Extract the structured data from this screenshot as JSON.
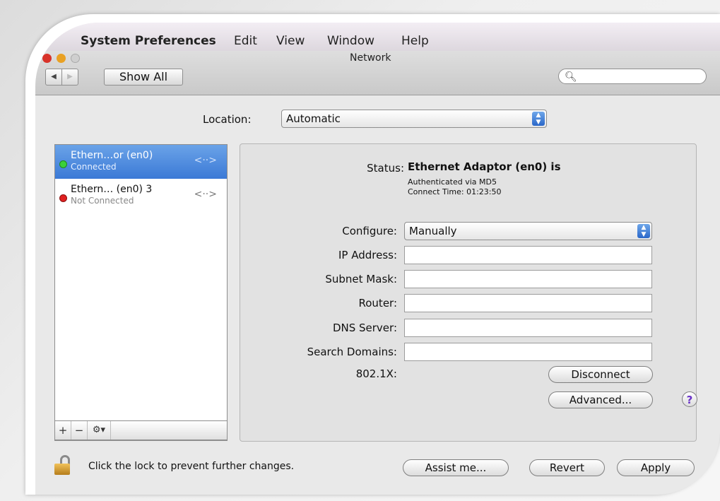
{
  "menubar": {
    "app": "System Preferences",
    "items": [
      "Edit",
      "View",
      "Window",
      "Help"
    ]
  },
  "window": {
    "title": "Network",
    "show_all": "Show All",
    "search_placeholder": ""
  },
  "location": {
    "label": "Location:",
    "value": "Automatic"
  },
  "services": [
    {
      "name": "Ethern…or (en0)",
      "status": "Connected",
      "indicator": "green",
      "selected": true
    },
    {
      "name": "Ethern… (en0) 3",
      "status": "Not Connected",
      "indicator": "red",
      "selected": false
    }
  ],
  "service_toolbar": {
    "add": "+",
    "remove": "−",
    "gear": "⚙▾"
  },
  "detail": {
    "status_label": "Status:",
    "status_value": "Ethernet Adaptor (en0) is",
    "status_line1": "Authenticated via MD5",
    "status_line2": "Connect Time: 01:23:50",
    "configure_label": "Configure:",
    "configure_value": "Manually",
    "ip_label": "IP Address:",
    "ip_value": "",
    "subnet_label": "Subnet Mask:",
    "subnet_value": "",
    "router_label": "Router:",
    "router_value": "",
    "dns_label": "DNS Server:",
    "dns_value": "",
    "search_domains_label": "Search Domains:",
    "search_domains_value": "",
    "dot1x_label": "802.1X:",
    "disconnect": "Disconnect",
    "advanced": "Advanced...",
    "help": "?"
  },
  "footer": {
    "lock_text": "Click the lock to prevent further changes.",
    "assist": "Assist me...",
    "revert": "Revert",
    "apply": "Apply"
  },
  "colors": {
    "selection": "#3b79d6",
    "connected": "#3bd03b",
    "not_connected": "#e02020",
    "help": "#6a32c8"
  }
}
